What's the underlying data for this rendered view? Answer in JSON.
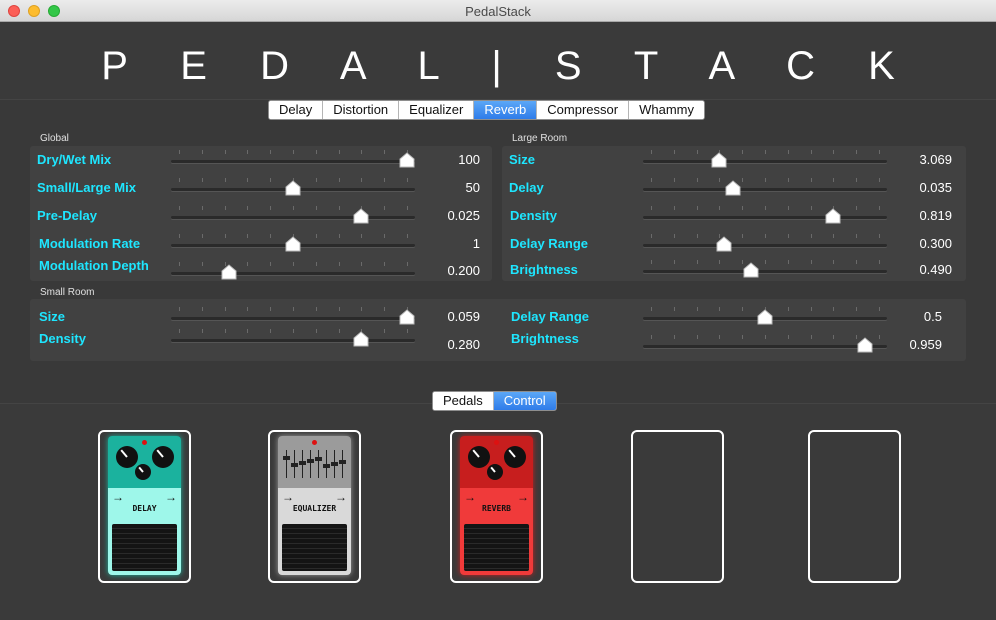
{
  "window": {
    "title": "PedalStack"
  },
  "logo": "P E D A L | S T A C K",
  "tabs": [
    {
      "label": "Delay",
      "active": false
    },
    {
      "label": "Distortion",
      "active": false
    },
    {
      "label": "Equalizer",
      "active": false
    },
    {
      "label": "Reverb",
      "active": true
    },
    {
      "label": "Compressor",
      "active": false
    },
    {
      "label": "Whammy",
      "active": false
    }
  ],
  "global": {
    "title": "Global",
    "params": [
      {
        "label": "Dry/Wet Mix",
        "value": "100",
        "level": 1.0
      },
      {
        "label": "Small/Large Mix",
        "value": "50",
        "level": 0.5
      },
      {
        "label": "Pre-Delay",
        "value": "0.025",
        "level": 0.8
      },
      {
        "label": "Modulation Rate",
        "value": "1",
        "level": 0.5
      },
      {
        "label": "Modulation Depth",
        "value": "0.200",
        "level": 0.22
      }
    ]
  },
  "large_room": {
    "title": "Large Room",
    "params": [
      {
        "label": "Size",
        "value": "3.069",
        "level": 0.3
      },
      {
        "label": "Delay",
        "value": "0.035",
        "level": 0.36
      },
      {
        "label": "Density",
        "value": "0.819",
        "level": 0.8
      },
      {
        "label": "Delay Range",
        "value": "0.300",
        "level": 0.32
      },
      {
        "label": "Brightness",
        "value": "0.490",
        "level": 0.44
      }
    ]
  },
  "small_room": {
    "title": "Small Room",
    "left_params": [
      {
        "label": "Size",
        "value": "0.059",
        "level": 1.0
      },
      {
        "label": "Density",
        "value": "0.280",
        "level": 0.8
      }
    ],
    "right_params": [
      {
        "label": "Delay Range",
        "value": "0.5",
        "level": 0.5
      },
      {
        "label": "Brightness",
        "value": "0.959",
        "level": 0.94
      }
    ]
  },
  "view_toggle": [
    {
      "label": "Pedals",
      "active": false
    },
    {
      "label": "Control",
      "active": true
    }
  ],
  "pedals": [
    {
      "name": "DELAY",
      "color_top": "#1bb29e",
      "color_mid": "#9ef7ea",
      "color_bot": "#9ef7ea",
      "type": "knobs"
    },
    {
      "name": "EQUALIZER",
      "color_top": "#9b9b9b",
      "color_mid": "#d9d9d9",
      "color_bot": "#d9d9d9",
      "type": "eq"
    },
    {
      "name": "REVERB",
      "color_top": "#c71e1e",
      "color_mid": "#f03a3a",
      "color_bot": "#f03a3a",
      "type": "knobs"
    }
  ],
  "arrow_glyph": "→"
}
